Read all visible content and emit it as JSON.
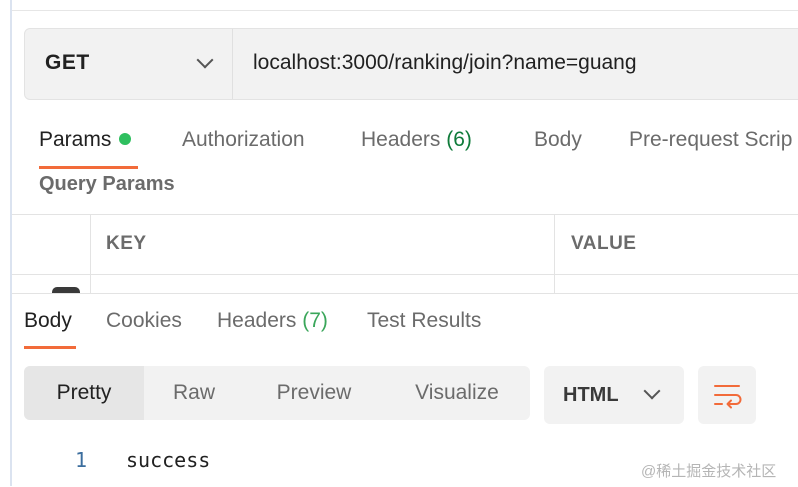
{
  "request": {
    "method": "GET",
    "url": "localhost:3000/ranking/join?name=guang"
  },
  "request_tabs": [
    {
      "label": "Params",
      "active": true,
      "indicator": "green-dot"
    },
    {
      "label": "Authorization"
    },
    {
      "label": "Headers",
      "count": "(6)"
    },
    {
      "label": "Body"
    },
    {
      "label": "Pre-request Scrip"
    }
  ],
  "query_params": {
    "title": "Query Params",
    "columns": [
      "KEY",
      "VALUE"
    ]
  },
  "response_tabs": [
    {
      "label": "Body",
      "active": true
    },
    {
      "label": "Cookies"
    },
    {
      "label": "Headers",
      "count": "(7)"
    },
    {
      "label": "Test Results"
    }
  ],
  "view_modes": [
    "Pretty",
    "Raw",
    "Preview",
    "Visualize"
  ],
  "active_view_mode": "Pretty",
  "format": "HTML",
  "response_body": [
    {
      "line": "1",
      "text": "success"
    }
  ],
  "watermark": "@稀土掘金技术社区",
  "colors": {
    "accent": "#f26b3a",
    "dot_green": "#2fbf5f",
    "count_green": "#0f7b3a"
  },
  "icons": {
    "method_dropdown": "chevron-down-icon",
    "format_dropdown": "chevron-down-icon",
    "wrap": "wrap-lines-icon"
  }
}
